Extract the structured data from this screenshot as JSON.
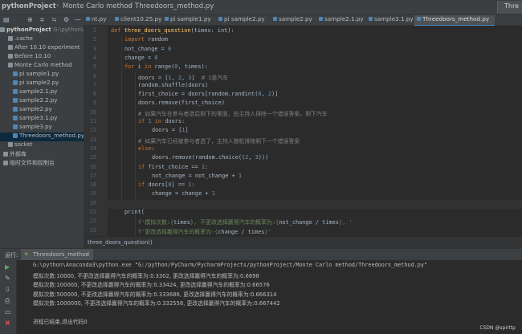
{
  "titlebar": {
    "breadcrumbs": [
      "pythonProject",
      "Monte Carlo method",
      "Threedoors_method.py"
    ],
    "run_config": "Thre"
  },
  "sidebar": {
    "project_label": "pythonProject",
    "project_path": "G:\\python\\PyC",
    "items": [
      {
        "label": ".cache",
        "kind": "folder"
      },
      {
        "label": "After 10.10 experiment",
        "kind": "folder"
      },
      {
        "label": "Before 10.10",
        "kind": "folder"
      },
      {
        "label": "Monte Carlo method",
        "kind": "folder"
      },
      {
        "label": "pi sample1.py",
        "kind": "py"
      },
      {
        "label": "pi sample2.py",
        "kind": "py"
      },
      {
        "label": "sample2.1.py",
        "kind": "py"
      },
      {
        "label": "sample2.2.py",
        "kind": "py"
      },
      {
        "label": "sample2.py",
        "kind": "py"
      },
      {
        "label": "sample3.1.py",
        "kind": "py"
      },
      {
        "label": "sample3.py",
        "kind": "py"
      },
      {
        "label": "Threedoors_method.py",
        "kind": "py"
      },
      {
        "label": "socket",
        "kind": "folder"
      },
      {
        "label": "外部库",
        "kind": "lib"
      },
      {
        "label": "临时文件和控制台",
        "kind": "lib"
      }
    ]
  },
  "tabs": [
    {
      "label": "nt.py"
    },
    {
      "label": "client10.25.py"
    },
    {
      "label": "pi sample1.py"
    },
    {
      "label": "pi sample2.py"
    },
    {
      "label": "sample2.py"
    },
    {
      "label": "sample2.1.py"
    },
    {
      "label": "sample3.1.py"
    },
    {
      "label": "Threedoors_method.py"
    }
  ],
  "editor": {
    "line_numbers": [
      "1",
      "2",
      "3",
      "4",
      "5",
      "6",
      "7",
      "8",
      "9",
      "10",
      "11",
      "12",
      "13",
      "14",
      "15",
      "16",
      "17",
      "18",
      "19",
      "20",
      "21",
      "22",
      "23"
    ],
    "lines": [
      {
        "indent": 0,
        "segs": [
          [
            "kw",
            "def "
          ],
          [
            "fn",
            "three_doors_question"
          ],
          [
            "t",
            "(times: "
          ],
          [
            "t",
            "int"
          ],
          [
            "t",
            "):"
          ]
        ]
      },
      {
        "indent": 1,
        "segs": [
          [
            "kw",
            "import "
          ],
          [
            "t",
            "random"
          ]
        ]
      },
      {
        "indent": 1,
        "segs": [
          [
            "t",
            "not_change = "
          ],
          [
            "num",
            "0"
          ]
        ]
      },
      {
        "indent": 1,
        "segs": [
          [
            "t",
            "change = "
          ],
          [
            "num",
            "0"
          ]
        ]
      },
      {
        "indent": 1,
        "segs": [
          [
            "kw",
            "for "
          ],
          [
            "t",
            "i "
          ],
          [
            "kw",
            "in "
          ],
          [
            "t",
            "range("
          ],
          [
            "num",
            "0"
          ],
          [
            "t",
            ", times):"
          ]
        ]
      },
      {
        "indent": 2,
        "segs": [
          [
            "t",
            "doors = ["
          ],
          [
            "num",
            "1"
          ],
          [
            "t",
            ", "
          ],
          [
            "num",
            "2"
          ],
          [
            "t",
            ", "
          ],
          [
            "num",
            "3"
          ],
          [
            "t",
            "]  "
          ],
          [
            "cm",
            "# 1是汽车"
          ]
        ]
      },
      {
        "indent": 2,
        "segs": [
          [
            "t",
            "random.shuffle(doors)"
          ]
        ]
      },
      {
        "indent": 2,
        "segs": [
          [
            "t",
            "first_choice = doors[random.randint("
          ],
          [
            "num",
            "0"
          ],
          [
            "t",
            ", "
          ],
          [
            "num",
            "2"
          ],
          [
            "t",
            ")]"
          ]
        ]
      },
      {
        "indent": 2,
        "segs": [
          [
            "t",
            "doors.remove(first_choice)"
          ]
        ]
      },
      {
        "indent": 2,
        "segs": [
          [
            "cm",
            "# 如果汽车在参与者选后剩下的里面，由主持人排除一个错误答案，剩下汽车"
          ]
        ]
      },
      {
        "indent": 2,
        "segs": [
          [
            "kw",
            "if "
          ],
          [
            "num",
            "1 "
          ],
          [
            "kw",
            "in "
          ],
          [
            "t",
            "doors:"
          ]
        ]
      },
      {
        "indent": 3,
        "segs": [
          [
            "t",
            "doors = ["
          ],
          [
            "num",
            "1"
          ],
          [
            "t",
            "]"
          ]
        ]
      },
      {
        "indent": 2,
        "segs": [
          [
            "cm",
            "# 如果汽车已经被参与者选了，主持人随机排除剩下一个错误答案"
          ]
        ]
      },
      {
        "indent": 2,
        "segs": [
          [
            "kw",
            "else"
          ],
          [
            "t",
            ":"
          ]
        ]
      },
      {
        "indent": 3,
        "segs": [
          [
            "t",
            "doors.remove(random.choice(("
          ],
          [
            "num",
            "2"
          ],
          [
            "t",
            ", "
          ],
          [
            "num",
            "3"
          ],
          [
            "t",
            ")))"
          ]
        ]
      },
      {
        "indent": 2,
        "segs": [
          [
            "kw",
            "if "
          ],
          [
            "t",
            "first_choice == "
          ],
          [
            "num",
            "1"
          ],
          [
            "t",
            ":"
          ]
        ]
      },
      {
        "indent": 3,
        "segs": [
          [
            "t",
            "not_change = not_change + "
          ],
          [
            "num",
            "1"
          ]
        ]
      },
      {
        "indent": 2,
        "segs": [
          [
            "kw",
            "if "
          ],
          [
            "t",
            "doors["
          ],
          [
            "num",
            "0"
          ],
          [
            "t",
            "] == "
          ],
          [
            "num",
            "1"
          ],
          [
            "t",
            ":"
          ]
        ]
      },
      {
        "indent": 3,
        "segs": [
          [
            "t",
            "change = change + "
          ],
          [
            "num",
            "1"
          ]
        ]
      },
      {
        "indent": 0,
        "segs": []
      },
      {
        "indent": 1,
        "segs": [
          [
            "t",
            "print("
          ]
        ]
      },
      {
        "indent": 2,
        "segs": [
          [
            "str",
            "f'模拟次数:{"
          ],
          [
            "t",
            "times"
          ],
          [
            "str",
            "}, 不更改选择赢得汽车的概率为:{"
          ],
          [
            "t",
            "not_change / times"
          ],
          [
            "str",
            "}, '"
          ]
        ]
      },
      {
        "indent": 2,
        "segs": [
          [
            "str",
            "f'更改选择赢得汽车的概率为:{"
          ],
          [
            "t",
            "change / times"
          ],
          [
            "str",
            "}'"
          ]
        ]
      }
    ]
  },
  "breadcrumb_bar": {
    "text": "three_doors_question()"
  },
  "run": {
    "label": "运行:",
    "tab": "Threedoors_method",
    "console_lines": [
      "G:\\python\\Anaconda3\\python.exe \"G:/python/PyCharm/PycharmProjects/pythonProject/Monte Carlo method/Threedoors_method.py\"",
      "模拟次数:10000, 不更改选择赢得汽车的概率为:0.3302, 更改选择赢得汽车的概率为:0.6698",
      "模拟次数:100000, 不更改选择赢得汽车的概率为:0.33424, 更改选择赢得汽车的概率为:0.66576",
      "模拟次数:500000, 不更改选择赢得汽车的概率为:0.333686, 更改选择赢得汽车的概率为:0.666314",
      "模拟次数:1000000, 不更改选择赢得汽车的概率为:0.332558, 更改选择赢得汽车的概率为:0.667442",
      "",
      "进程已结束,退出代码0"
    ]
  },
  "watermark": "CSDN @spirttp"
}
